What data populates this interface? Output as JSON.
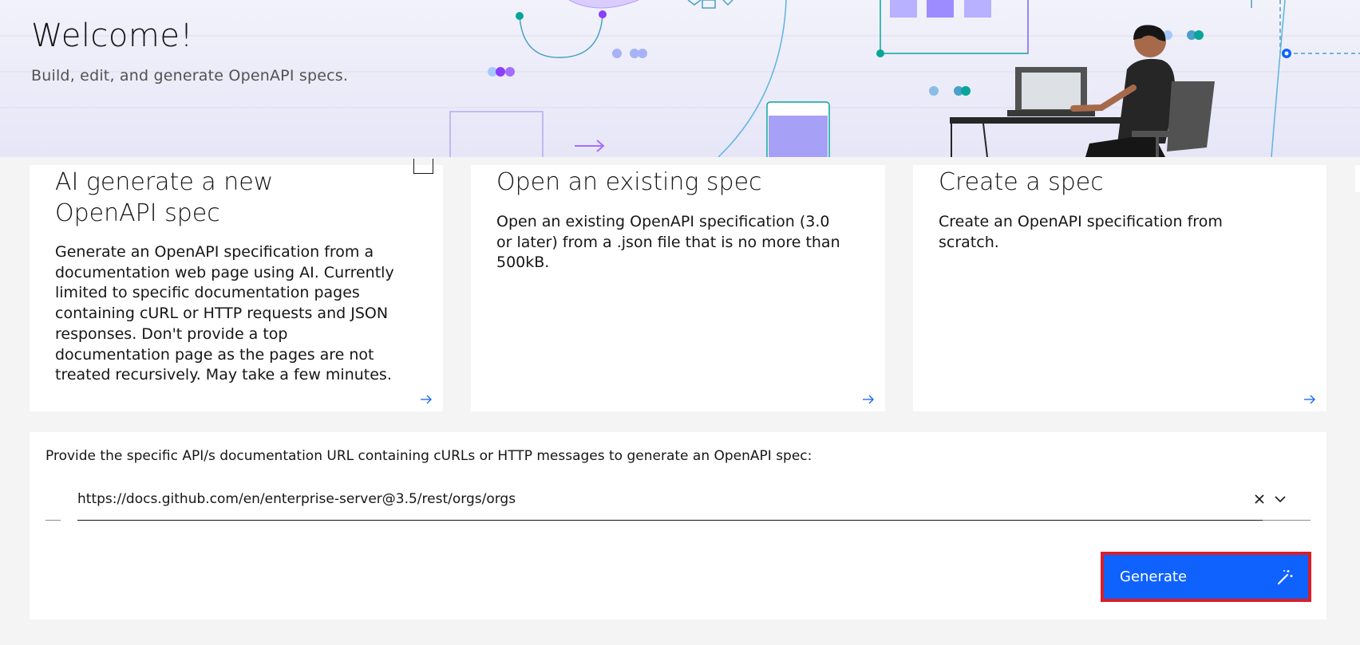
{
  "hero": {
    "title": "Welcome!",
    "subtitle": "Build, edit, and generate OpenAPI specs."
  },
  "cards": [
    {
      "title": "AI generate a new OpenAPI spec",
      "description": "Generate an OpenAPI specification from a documentation web page using AI. Currently limited to specific documentation pages containing cURL or HTTP requests and JSON responses. Don't provide a top documentation page as the pages are not treated recursively. May take a few minutes.",
      "icon": "arrow-right-icon"
    },
    {
      "title": "Open an existing spec",
      "description": "Open an existing OpenAPI specification (3.0 or later) from a .json file that is no more than 500kB.",
      "icon": "arrow-right-icon"
    },
    {
      "title": "Create a spec",
      "description": "Create an OpenAPI specification from scratch.",
      "icon": "arrow-right-icon"
    }
  ],
  "generate_panel": {
    "label": "Provide the specific API/s documentation URL containing cURLs or HTTP messages to generate an OpenAPI spec:",
    "url_value": "https://docs.github.com/en/enterprise-server@3.5/rest/orgs/orgs",
    "clear_icon": "close-icon",
    "dropdown_icon": "chevron-down-icon",
    "button_label": "Generate",
    "button_icon": "magic-wand-icon"
  },
  "colors": {
    "accent": "#0f62fe",
    "highlight_border": "#da1e28",
    "hero_background": "#e8e8f8",
    "page_background": "#f4f4f4"
  }
}
